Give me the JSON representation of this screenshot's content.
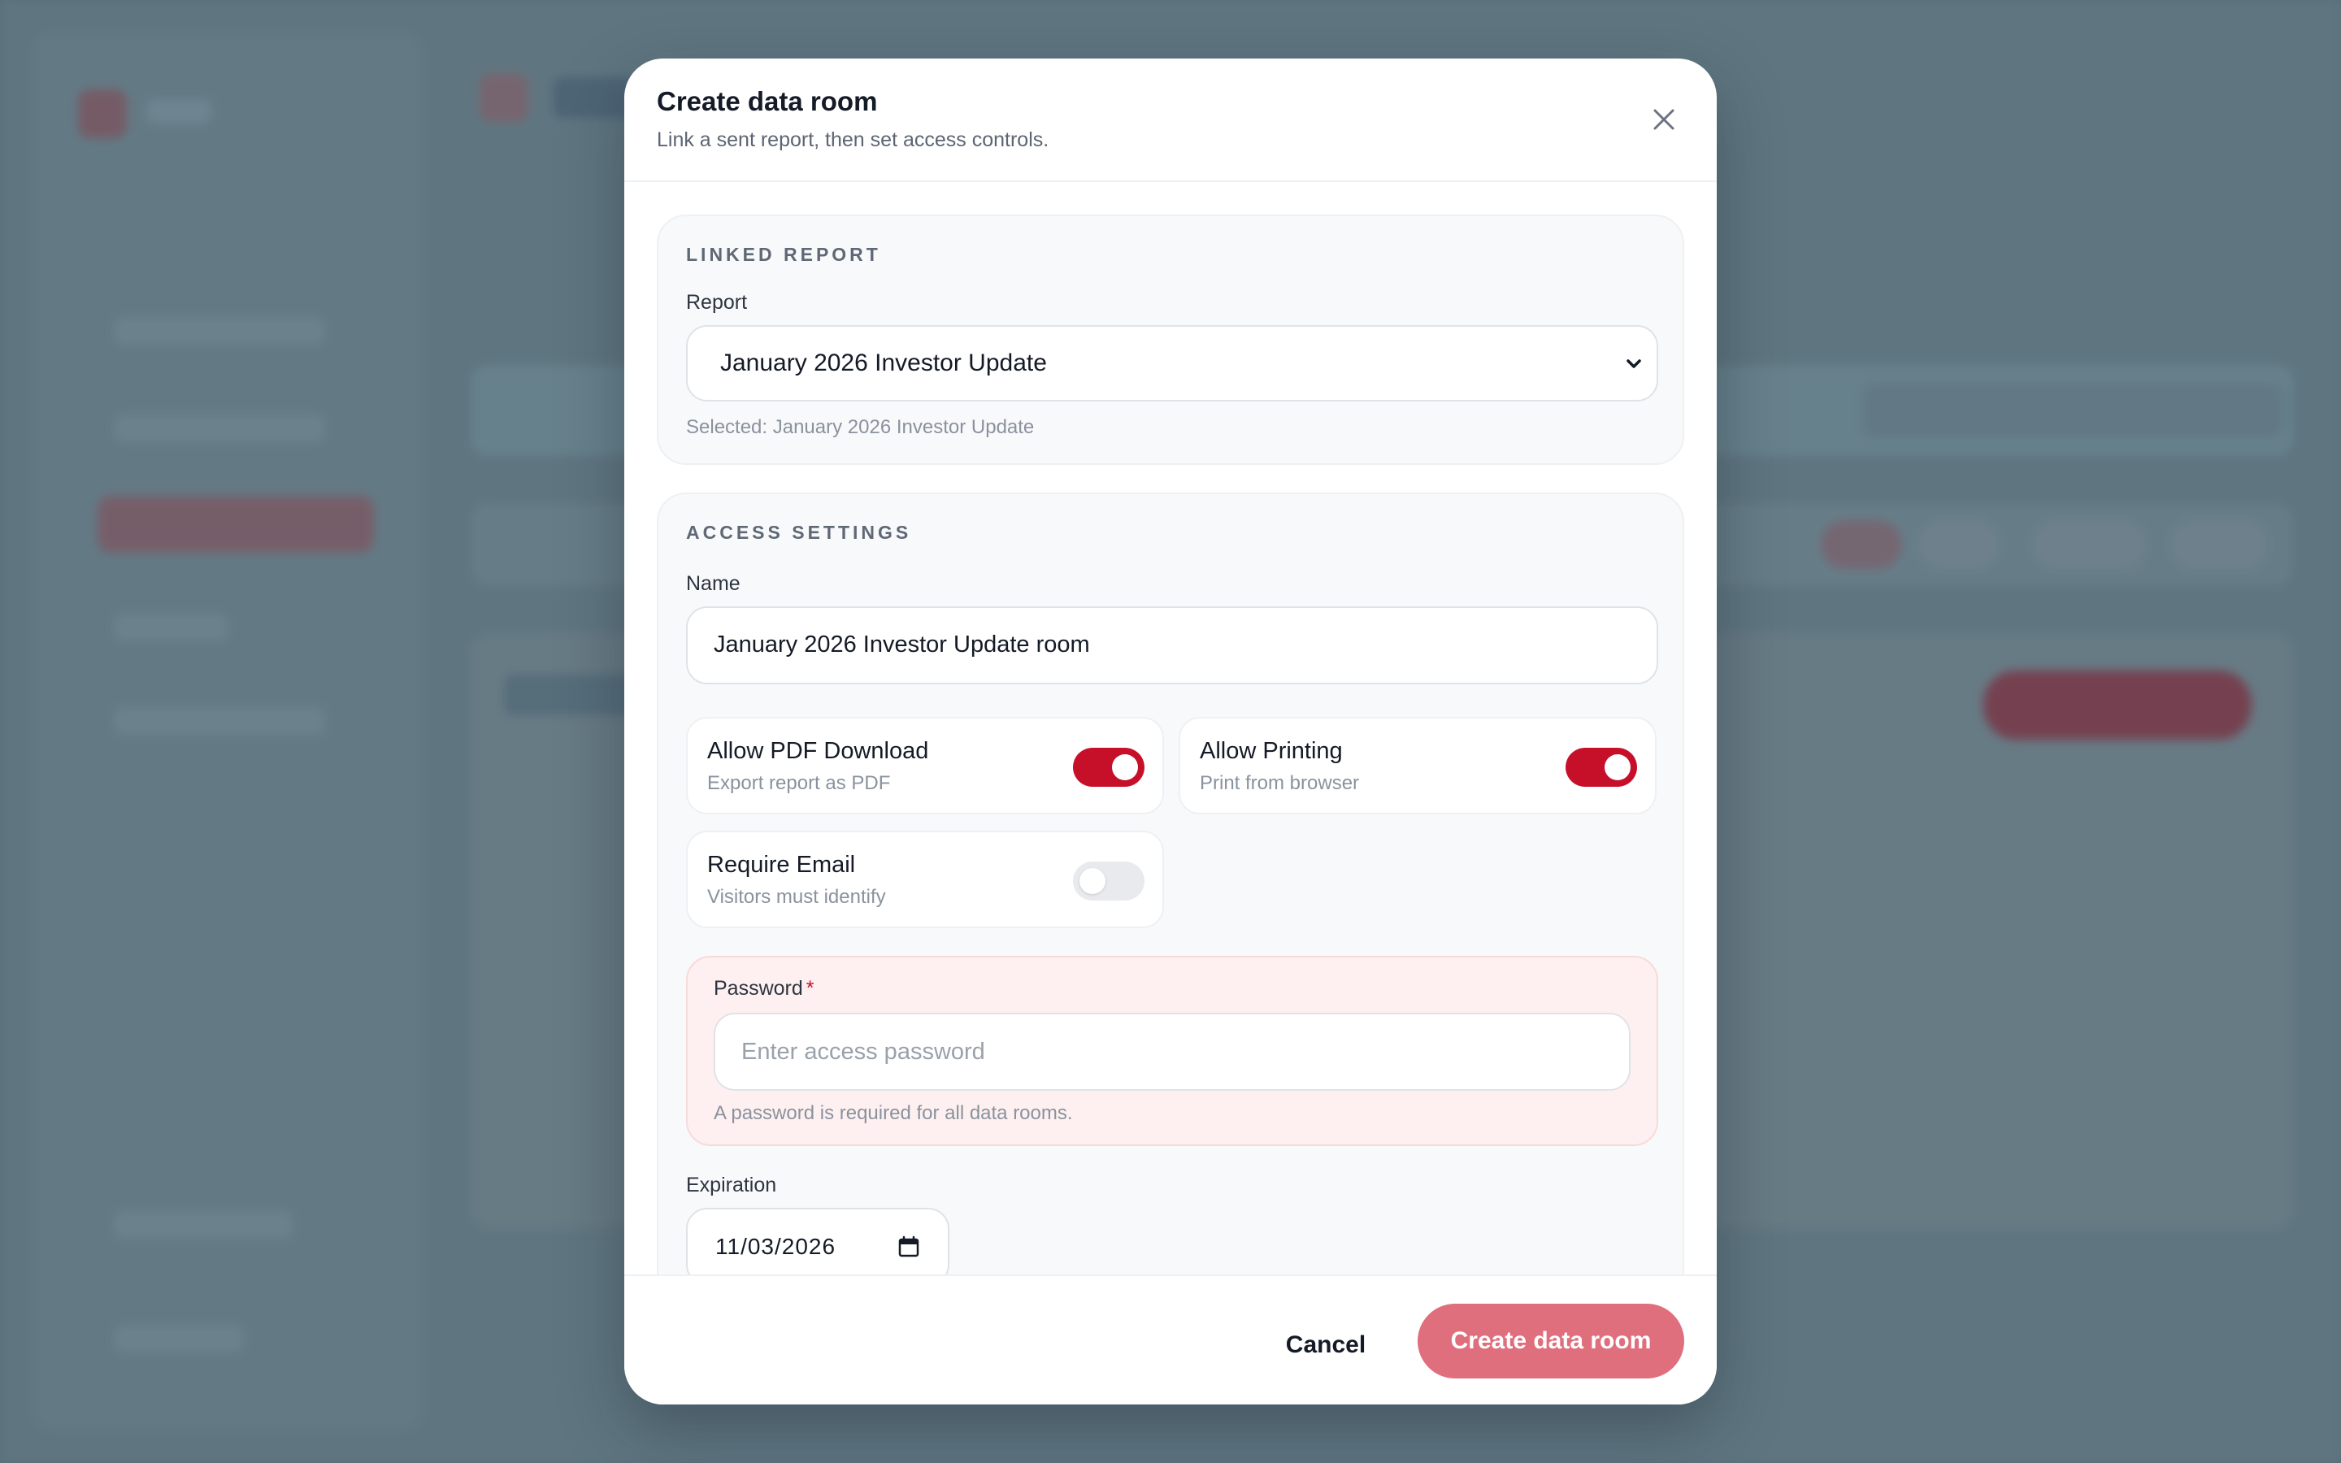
{
  "modal": {
    "title": "Create data room",
    "subtitle": "Link a sent report, then set access controls."
  },
  "linked_report": {
    "section_label": "LINKED REPORT",
    "report_label": "Report",
    "report_value": "January 2026 Investor Update",
    "selected_text": "Selected: January 2026 Investor Update"
  },
  "access_settings": {
    "section_label": "ACCESS SETTINGS",
    "name_label": "Name",
    "name_value": "January 2026 Investor Update room",
    "toggles": [
      {
        "title": "Allow PDF Download",
        "subtitle": "Export report as PDF",
        "on": true
      },
      {
        "title": "Allow Printing",
        "subtitle": "Print from browser",
        "on": true
      },
      {
        "title": "Require Email",
        "subtitle": "Visitors must identify",
        "on": false
      }
    ],
    "password": {
      "label": "Password",
      "required_mark": "*",
      "placeholder": "Enter access password",
      "helper": "A password is required for all data rooms."
    },
    "expiration": {
      "label": "Expiration",
      "value": "11/03/2026"
    }
  },
  "footer": {
    "cancel_label": "Cancel",
    "create_label": "Create data room"
  },
  "colors": {
    "accent": "#c6102a",
    "primary_button": "#df6f7d",
    "error_background": "#fef0f0"
  },
  "icons": [
    "close-icon",
    "chevron-down-icon",
    "calendar-icon"
  ]
}
